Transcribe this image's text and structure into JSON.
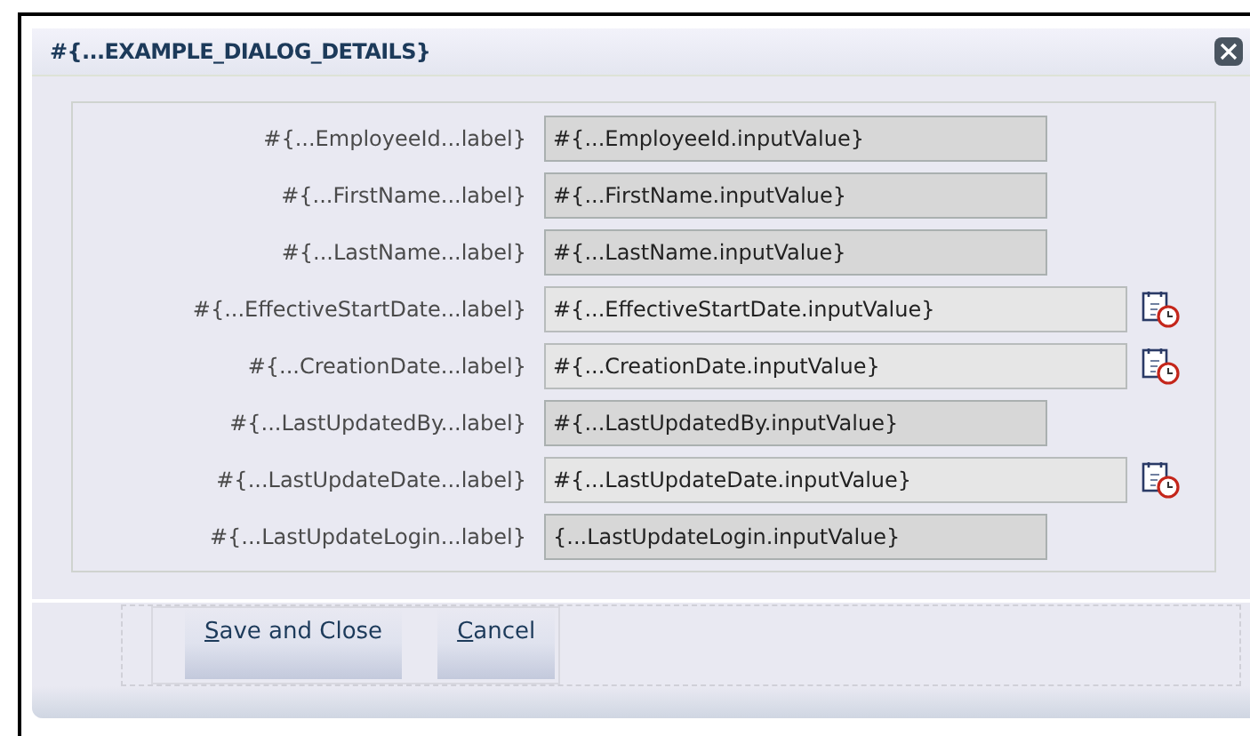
{
  "dialog": {
    "title": "#{...EXAMPLE_DIALOG_DETAILS}"
  },
  "fields": [
    {
      "label": "#{...EmployeeId...label}",
      "value": "#{...EmployeeId.inputValue}",
      "kind": "text",
      "disabled": true
    },
    {
      "label": "#{...FirstName...label}",
      "value": "#{...FirstName.inputValue}",
      "kind": "text",
      "disabled": true
    },
    {
      "label": "#{...LastName...label}",
      "value": "#{...LastName.inputValue}",
      "kind": "text",
      "disabled": true
    },
    {
      "label": "#{...EffectiveStartDate...label}",
      "value": "#{...EffectiveStartDate.inputValue}",
      "kind": "date",
      "disabled": false
    },
    {
      "label": "#{...CreationDate...label}",
      "value": "#{...CreationDate.inputValue}",
      "kind": "date",
      "disabled": false
    },
    {
      "label": "#{...LastUpdatedBy...label}",
      "value": "#{...LastUpdatedBy.inputValue}",
      "kind": "text",
      "disabled": true
    },
    {
      "label": "#{...LastUpdateDate...label}",
      "value": "#{...LastUpdateDate.inputValue}",
      "kind": "date",
      "disabled": false
    },
    {
      "label": "#{...LastUpdateLogin...label}",
      "value": "{...LastUpdateLogin.inputValue}",
      "kind": "text",
      "disabled": true
    }
  ],
  "buttons": [
    {
      "label": "Save and Close",
      "mnemonic_underlined": true
    },
    {
      "label": "Cancel",
      "mnemonic_underlined": true
    }
  ]
}
